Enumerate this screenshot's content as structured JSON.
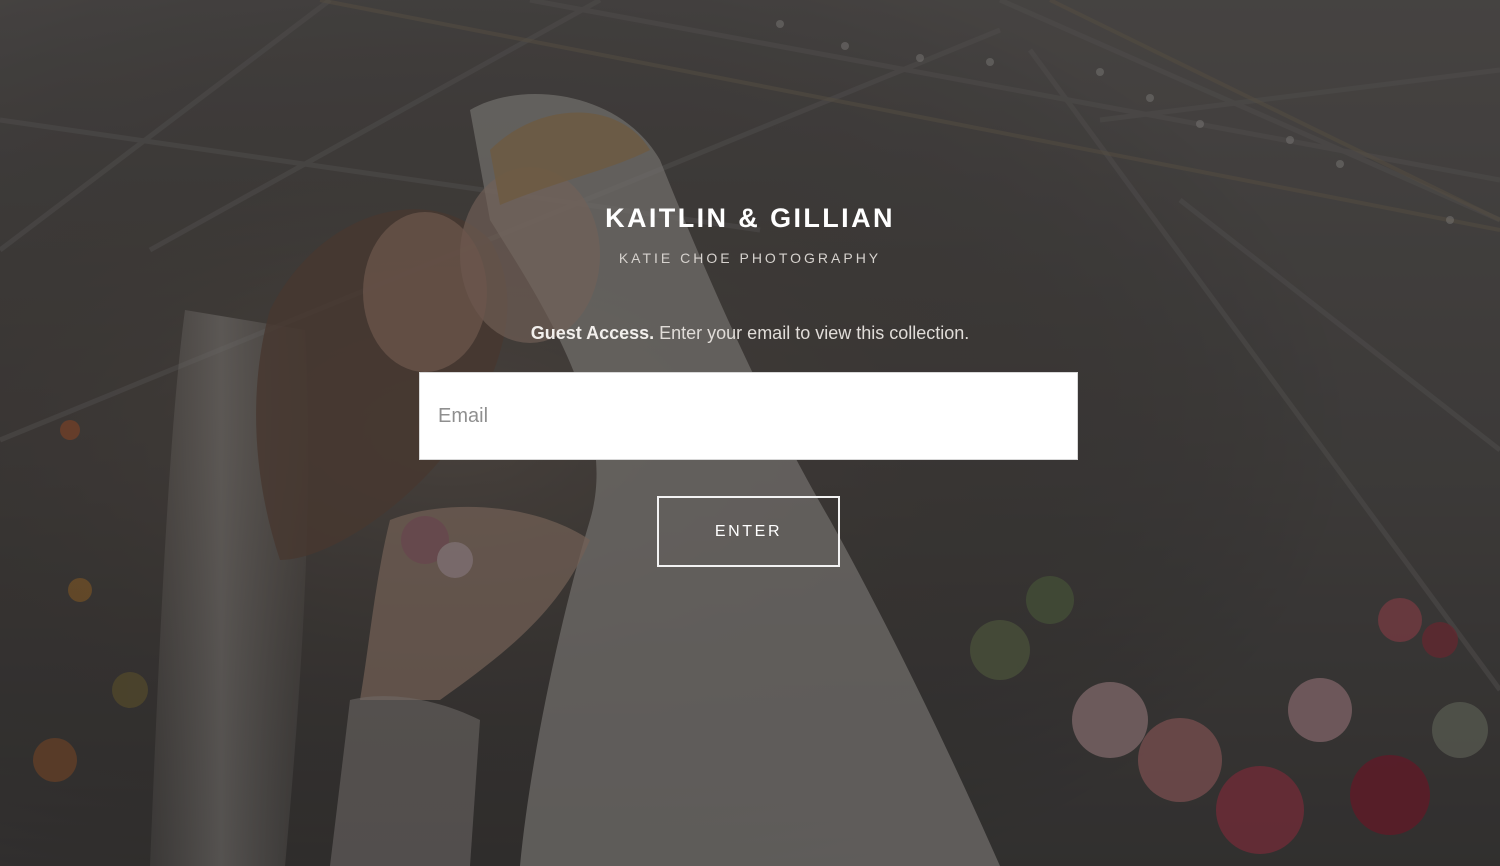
{
  "gallery": {
    "title": "KAITLIN & GILLIAN",
    "photographer": "KATIE CHOE PHOTOGRAPHY"
  },
  "access": {
    "heading": "Guest Access.",
    "message": "Enter your email to view this collection."
  },
  "form": {
    "email_placeholder": "Email",
    "email_value": "",
    "submit_label": "ENTER"
  },
  "colors": {
    "overlay": "#1e1c1c",
    "button_border": "#f3f3f3",
    "input_background": "#ffffff"
  }
}
